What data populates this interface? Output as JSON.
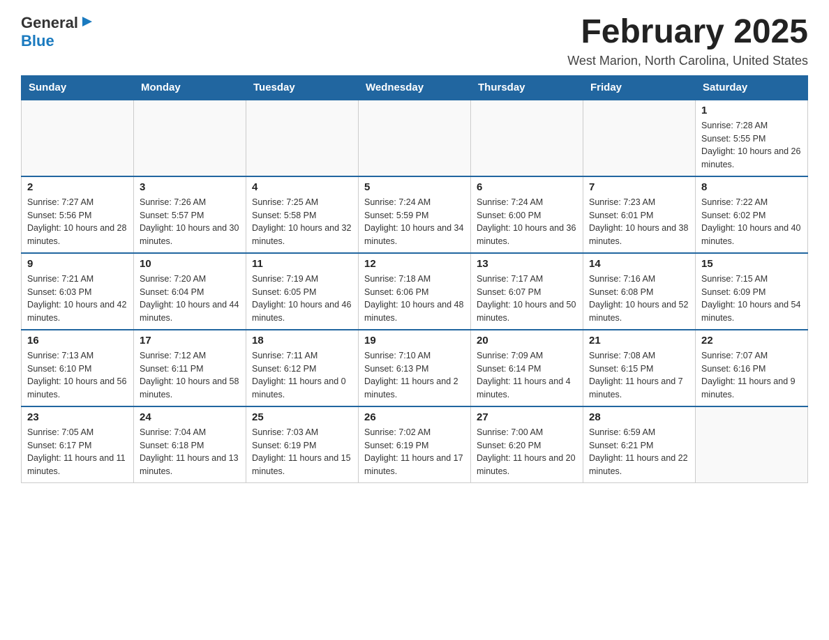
{
  "header": {
    "logo": {
      "general": "General",
      "blue": "Blue",
      "triangle": "▶"
    },
    "title": "February 2025",
    "location": "West Marion, North Carolina, United States"
  },
  "days_of_week": [
    "Sunday",
    "Monday",
    "Tuesday",
    "Wednesday",
    "Thursday",
    "Friday",
    "Saturday"
  ],
  "weeks": [
    [
      {
        "day": "",
        "info": ""
      },
      {
        "day": "",
        "info": ""
      },
      {
        "day": "",
        "info": ""
      },
      {
        "day": "",
        "info": ""
      },
      {
        "day": "",
        "info": ""
      },
      {
        "day": "",
        "info": ""
      },
      {
        "day": "1",
        "info": "Sunrise: 7:28 AM\nSunset: 5:55 PM\nDaylight: 10 hours and 26 minutes."
      }
    ],
    [
      {
        "day": "2",
        "info": "Sunrise: 7:27 AM\nSunset: 5:56 PM\nDaylight: 10 hours and 28 minutes."
      },
      {
        "day": "3",
        "info": "Sunrise: 7:26 AM\nSunset: 5:57 PM\nDaylight: 10 hours and 30 minutes."
      },
      {
        "day": "4",
        "info": "Sunrise: 7:25 AM\nSunset: 5:58 PM\nDaylight: 10 hours and 32 minutes."
      },
      {
        "day": "5",
        "info": "Sunrise: 7:24 AM\nSunset: 5:59 PM\nDaylight: 10 hours and 34 minutes."
      },
      {
        "day": "6",
        "info": "Sunrise: 7:24 AM\nSunset: 6:00 PM\nDaylight: 10 hours and 36 minutes."
      },
      {
        "day": "7",
        "info": "Sunrise: 7:23 AM\nSunset: 6:01 PM\nDaylight: 10 hours and 38 minutes."
      },
      {
        "day": "8",
        "info": "Sunrise: 7:22 AM\nSunset: 6:02 PM\nDaylight: 10 hours and 40 minutes."
      }
    ],
    [
      {
        "day": "9",
        "info": "Sunrise: 7:21 AM\nSunset: 6:03 PM\nDaylight: 10 hours and 42 minutes."
      },
      {
        "day": "10",
        "info": "Sunrise: 7:20 AM\nSunset: 6:04 PM\nDaylight: 10 hours and 44 minutes."
      },
      {
        "day": "11",
        "info": "Sunrise: 7:19 AM\nSunset: 6:05 PM\nDaylight: 10 hours and 46 minutes."
      },
      {
        "day": "12",
        "info": "Sunrise: 7:18 AM\nSunset: 6:06 PM\nDaylight: 10 hours and 48 minutes."
      },
      {
        "day": "13",
        "info": "Sunrise: 7:17 AM\nSunset: 6:07 PM\nDaylight: 10 hours and 50 minutes."
      },
      {
        "day": "14",
        "info": "Sunrise: 7:16 AM\nSunset: 6:08 PM\nDaylight: 10 hours and 52 minutes."
      },
      {
        "day": "15",
        "info": "Sunrise: 7:15 AM\nSunset: 6:09 PM\nDaylight: 10 hours and 54 minutes."
      }
    ],
    [
      {
        "day": "16",
        "info": "Sunrise: 7:13 AM\nSunset: 6:10 PM\nDaylight: 10 hours and 56 minutes."
      },
      {
        "day": "17",
        "info": "Sunrise: 7:12 AM\nSunset: 6:11 PM\nDaylight: 10 hours and 58 minutes."
      },
      {
        "day": "18",
        "info": "Sunrise: 7:11 AM\nSunset: 6:12 PM\nDaylight: 11 hours and 0 minutes."
      },
      {
        "day": "19",
        "info": "Sunrise: 7:10 AM\nSunset: 6:13 PM\nDaylight: 11 hours and 2 minutes."
      },
      {
        "day": "20",
        "info": "Sunrise: 7:09 AM\nSunset: 6:14 PM\nDaylight: 11 hours and 4 minutes."
      },
      {
        "day": "21",
        "info": "Sunrise: 7:08 AM\nSunset: 6:15 PM\nDaylight: 11 hours and 7 minutes."
      },
      {
        "day": "22",
        "info": "Sunrise: 7:07 AM\nSunset: 6:16 PM\nDaylight: 11 hours and 9 minutes."
      }
    ],
    [
      {
        "day": "23",
        "info": "Sunrise: 7:05 AM\nSunset: 6:17 PM\nDaylight: 11 hours and 11 minutes."
      },
      {
        "day": "24",
        "info": "Sunrise: 7:04 AM\nSunset: 6:18 PM\nDaylight: 11 hours and 13 minutes."
      },
      {
        "day": "25",
        "info": "Sunrise: 7:03 AM\nSunset: 6:19 PM\nDaylight: 11 hours and 15 minutes."
      },
      {
        "day": "26",
        "info": "Sunrise: 7:02 AM\nSunset: 6:19 PM\nDaylight: 11 hours and 17 minutes."
      },
      {
        "day": "27",
        "info": "Sunrise: 7:00 AM\nSunset: 6:20 PM\nDaylight: 11 hours and 20 minutes."
      },
      {
        "day": "28",
        "info": "Sunrise: 6:59 AM\nSunset: 6:21 PM\nDaylight: 11 hours and 22 minutes."
      },
      {
        "day": "",
        "info": ""
      }
    ]
  ]
}
